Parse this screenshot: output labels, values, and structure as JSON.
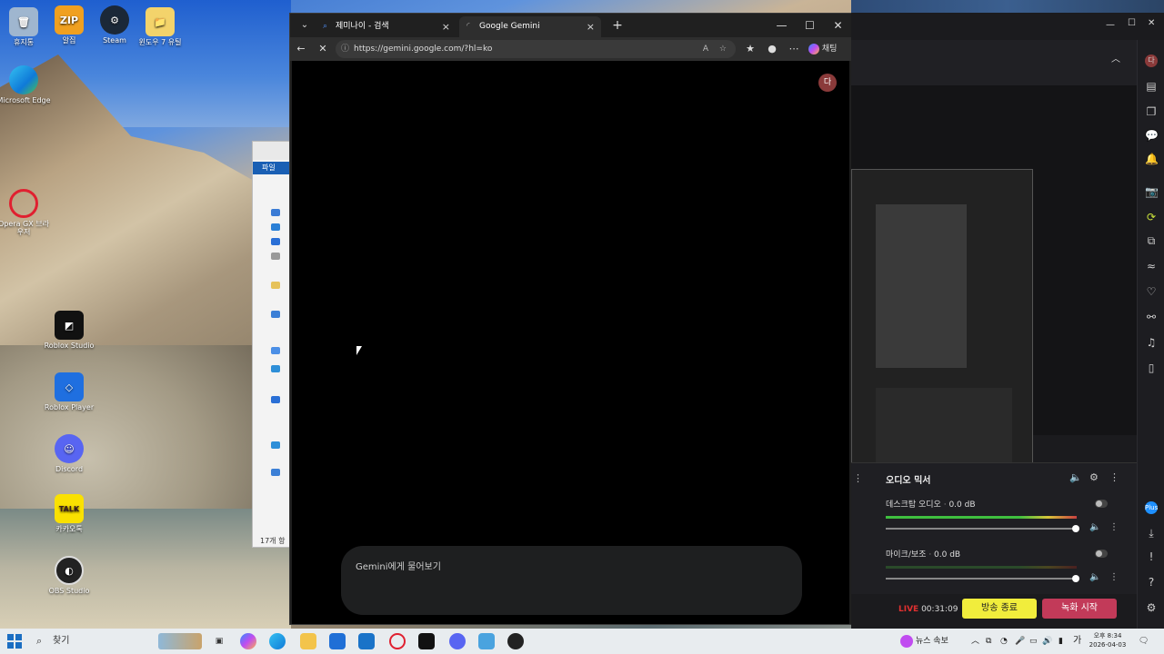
{
  "desktop": {
    "icons": [
      {
        "label": "휴지통",
        "icon": "recycle-bin-icon"
      },
      {
        "label": "알집",
        "icon": "zip-icon",
        "glyph": "ZIP"
      },
      {
        "label": "Steam",
        "icon": "steam-icon"
      },
      {
        "label": "윈도우 7 유틸",
        "icon": "folder-icon"
      },
      {
        "label": "Microsoft Edge",
        "icon": "edge-icon"
      },
      {
        "label": "Opera GX 브라우저",
        "icon": "opera-gx-icon"
      },
      {
        "label": "Roblox Studio",
        "icon": "roblox-studio-icon"
      },
      {
        "label": "Roblox Player",
        "icon": "roblox-player-icon"
      },
      {
        "label": "Discord",
        "icon": "discord-icon"
      },
      {
        "label": "카카오톡",
        "icon": "kakaotalk-icon",
        "glyph": "TALK"
      },
      {
        "label": "OBS Studio",
        "icon": "obs-studio-icon"
      }
    ]
  },
  "explorer": {
    "file_tab": "파일",
    "item_count": "17개 항"
  },
  "browser": {
    "tabs": [
      {
        "label": "제미나이 - 검색",
        "active": false
      },
      {
        "label": "Google Gemini",
        "active": true
      }
    ],
    "new_tab": "+",
    "url": "https://gemini.google.com/?hl=ko",
    "copilot_label": "채팅",
    "window_controls": {
      "minimize": "—",
      "maximize": "☐",
      "close": "✕"
    },
    "page": {
      "avatar_letter": "다",
      "prompt_placeholder": "Gemini에게 물어보기"
    }
  },
  "obs": {
    "mixer": {
      "title": "오디오 믹서",
      "tracks": [
        {
          "name": "데스크탑 오디오",
          "db": "0.0 dB"
        },
        {
          "name": "마이크/보조",
          "db": "0.0 dB"
        }
      ]
    },
    "status": {
      "live_label": "LIVE",
      "live_time": "00:31:09",
      "stop_stream": "방송 종료",
      "start_record": "녹화 시작"
    },
    "side_badge": "Plus"
  },
  "taskbar": {
    "search_label": "찾기",
    "news_label": "뉴스 속보",
    "ime_label": "가",
    "time": "오후 8:34",
    "date": "2026-04-03"
  },
  "colors": {
    "stop_stream_bg": "#f1ed3c",
    "start_record_bg": "#c23a59",
    "live_red": "#e03030"
  }
}
